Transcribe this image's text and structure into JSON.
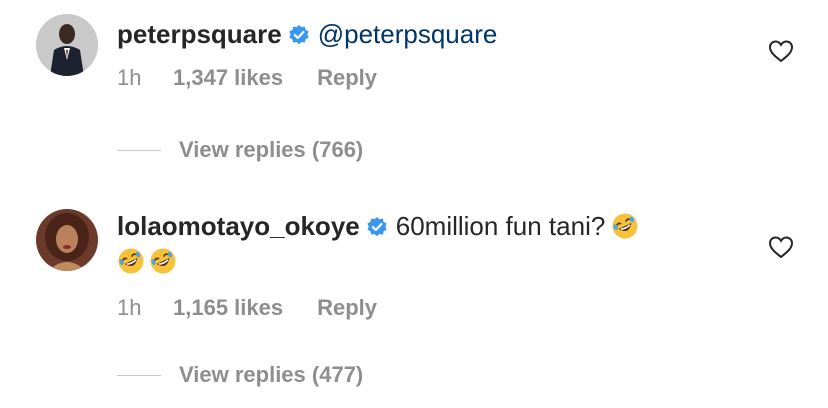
{
  "comments": [
    {
      "username": "peterpsquare",
      "text": "@peterpsquare",
      "time": "1h",
      "likes": "1,347 likes",
      "reply": "Reply",
      "view_replies": "View replies (766)",
      "avatar_icon": "avatar-man-suit"
    },
    {
      "username": "lolaomotayo_okoye",
      "text": "60million fun tani?",
      "time": "1h",
      "likes": "1,165 likes",
      "reply": "Reply",
      "view_replies": "View replies (477)",
      "avatar_icon": "avatar-woman",
      "emojis": [
        "rolling-on-floor-laughing",
        "rolling-on-floor-laughing",
        "rolling-on-floor-laughing"
      ]
    }
  ],
  "colors": {
    "verified_blue": "#3897f0",
    "link_blue": "#003569",
    "meta_gray": "#8e8e8e"
  }
}
